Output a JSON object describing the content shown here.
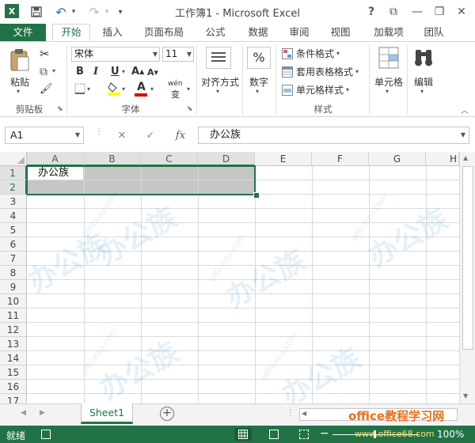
{
  "window": {
    "title": "工作簿1 - Microsoft Excel",
    "help": "?",
    "ribbon_display": "⧉",
    "minimize": "—",
    "restore": "❐",
    "close": "✕"
  },
  "quick_access": {
    "logo": "X",
    "undo": "↶",
    "redo": "↷",
    "customize": "▾"
  },
  "tabs": [
    "文件",
    "开始",
    "插入",
    "页面布局",
    "公式",
    "数据",
    "审阅",
    "视图",
    "加载项",
    "团队"
  ],
  "ribbon": {
    "clipboard": {
      "label": "剪贴板",
      "paste_label": "粘贴",
      "cut": "✂",
      "copy": "⧉",
      "painter": "🖌"
    },
    "font": {
      "label": "字体",
      "font_name": "宋体",
      "font_size": "11",
      "bold": "B",
      "italic": "I",
      "underline": "U",
      "grow": "A",
      "shrink": "A",
      "font_color_glyph": "A",
      "phonetic": "wén",
      "phonetic_sub": "变"
    },
    "alignment": {
      "label": "对齐方式"
    },
    "number": {
      "label": "数字",
      "glyph": "%"
    },
    "styles": {
      "label": "样式",
      "conditional": "条件格式",
      "table_format": "套用表格格式",
      "cell_styles": "单元格样式"
    },
    "cells": {
      "label": "单元格"
    },
    "editing": {
      "label": "编辑"
    }
  },
  "formula_bar": {
    "name_box": "A1",
    "cancel": "✕",
    "enter": "✓",
    "fx": "fx",
    "content": "办公族"
  },
  "grid": {
    "columns": [
      "A",
      "B",
      "C",
      "D",
      "E",
      "F",
      "G",
      "H"
    ],
    "selected_columns": [
      "A",
      "B",
      "C",
      "D"
    ],
    "rows": [
      "1",
      "2",
      "3",
      "4",
      "5",
      "6",
      "7",
      "8",
      "9",
      "10",
      "11",
      "12",
      "13",
      "14",
      "15",
      "16",
      "17"
    ],
    "selected_rows": [
      "1",
      "2"
    ],
    "cells": {
      "A1": "办公族"
    }
  },
  "sheets": {
    "active": "Sheet1",
    "add": "+"
  },
  "status": {
    "ready": "就绪",
    "brand": "office教程学习网",
    "brand_url": "www.office68.com",
    "zoom": "100%"
  },
  "watermark": {
    "brand": "办公族",
    "url": "officezu.com"
  },
  "colors": {
    "accent": "#217346",
    "selection": "#c6c6c6"
  }
}
